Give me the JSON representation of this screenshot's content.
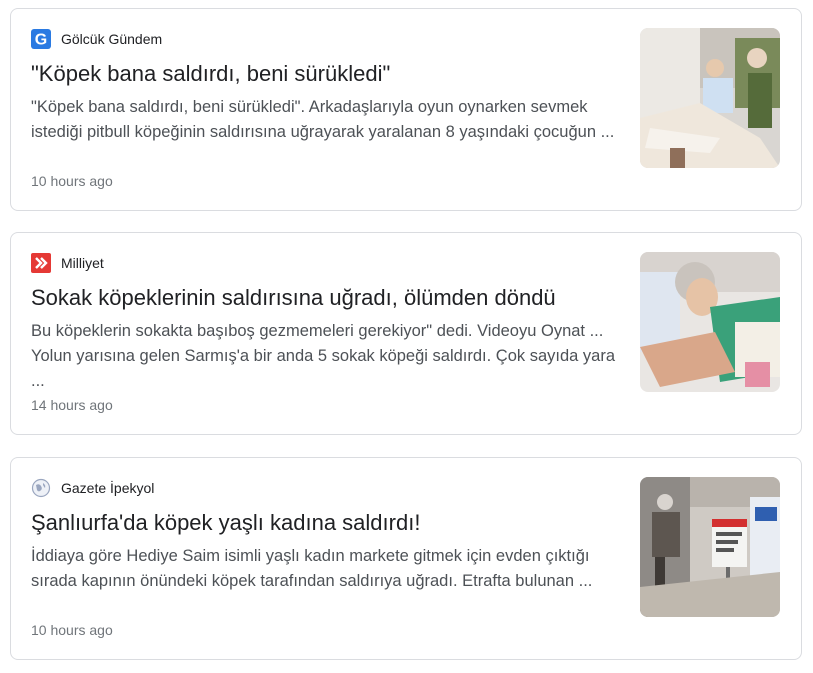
{
  "results": [
    {
      "source": "Gölcük Gündem",
      "headline": "\"Köpek bana saldırdı, beni sürükledi\"",
      "snippet": "\"Köpek bana saldırdı, beni sürükledi\". Arkadaşlarıyla oyun oynarken sevmek istediği pitbull köpeğinin saldırısına uğrayarak yaralanan 8 yaşındaki çocuğun ...",
      "time": "10 hours ago",
      "favicon": "g-letter-icon",
      "favicon_color": "#2a7ae2"
    },
    {
      "source": "Milliyet",
      "headline": "Sokak köpeklerinin saldırısına uğradı, ölümden döndü",
      "snippet": "Bu köpeklerin sokakta başıboş gezmemeleri gerekiyor\" dedi. Videoyu Oynat ... Yolun yarısına gelen Sarmış'a bir anda 5 sokak köpeği saldırdı. Çok sayıda yara ...",
      "time": "14 hours ago",
      "favicon": "double-chevron-icon",
      "favicon_color": "#e53935"
    },
    {
      "source": "Gazete İpekyol",
      "headline": "Şanlıurfa'da köpek yaşlı kadına saldırdı!",
      "snippet": "İddiaya göre Hediye Saim isimli yaşlı kadın markete gitmek için evden çıktığı sırada kapının önündeki köpek tarafından saldırıya uğradı. Etrafta bulunan ...",
      "time": "10 hours ago",
      "favicon": "globe-icon",
      "favicon_color": "#8ab4f8"
    }
  ]
}
